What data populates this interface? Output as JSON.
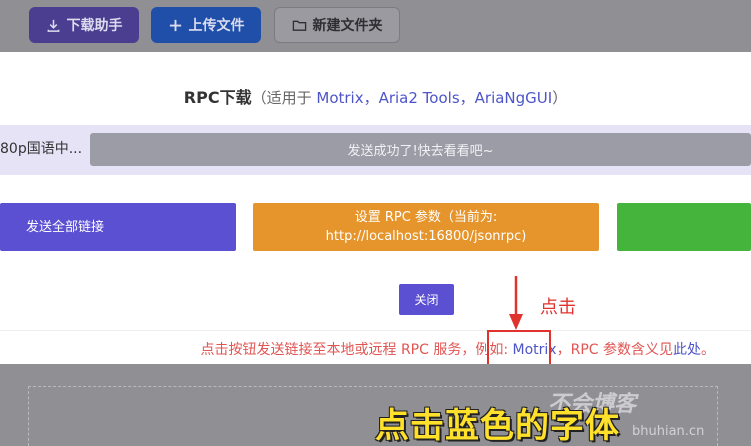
{
  "toolbar": {
    "download_helper": "下载助手",
    "upload_file": "上传文件",
    "new_folder": "新建文件夹"
  },
  "modal": {
    "title_main": "RPC下载",
    "title_open": "（适用于",
    "title_tools": "Motrix，Aria2 Tools，AriaNgGUI",
    "title_close": "）",
    "file_name": "80p国语中...",
    "status_text": "发送成功了!快去看看吧~",
    "send_all_label": "发送全部链接",
    "set_rpc_line1": "设置 RPC 参数（当前为:",
    "set_rpc_line2": "http://localhost:16800/jsonrpc)",
    "close_label": "关闭",
    "hint_prefix": "点击按钮发送链接至本地或远程 RPC 服务，例如: ",
    "hint_link": "Motrix",
    "hint_mid": "，RPC 参数含义见",
    "hint_here": "此处",
    "hint_end": "。"
  },
  "annotation": {
    "click_note": "点击",
    "caption": "点击蓝色的字体"
  },
  "watermark": {
    "main": "不会博客",
    "sub": "bhuhian.cn"
  },
  "colors": {
    "accent_purple": "#5b4fd2",
    "accent_orange": "#e6952c",
    "accent_green": "#44b43c",
    "hint_red": "#e05552",
    "link_blue": "#4d55c8"
  }
}
